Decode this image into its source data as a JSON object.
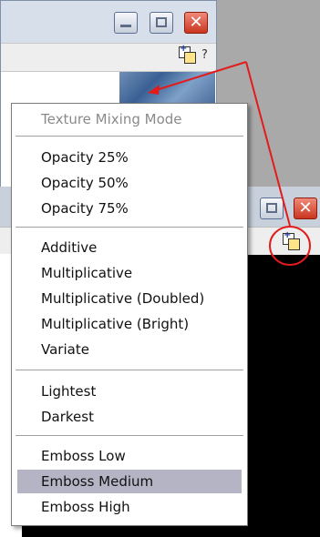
{
  "menu": {
    "header": "Texture Mixing Mode",
    "opacity": [
      "Opacity 25%",
      "Opacity 50%",
      "Opacity 75%"
    ],
    "blend": [
      "Additive",
      "Multiplicative",
      "Multiplicative (Doubled)",
      "Multiplicative (Bright)",
      "Variate"
    ],
    "lightdark": [
      "Lightest",
      "Darkest"
    ],
    "emboss": [
      "Emboss Low",
      "Emboss Medium",
      "Emboss High"
    ],
    "selected": "Emboss Medium"
  },
  "toolbar": {
    "help_label": "?"
  },
  "icons": {
    "minimize": "minimize-icon",
    "maximize": "maximize-icon",
    "close": "close-icon",
    "texture_mode": "texture-mode-icon"
  },
  "colors": {
    "annotation": "#e21b1b",
    "selection": "#b4b4c4",
    "close_button": "#c9361f"
  }
}
